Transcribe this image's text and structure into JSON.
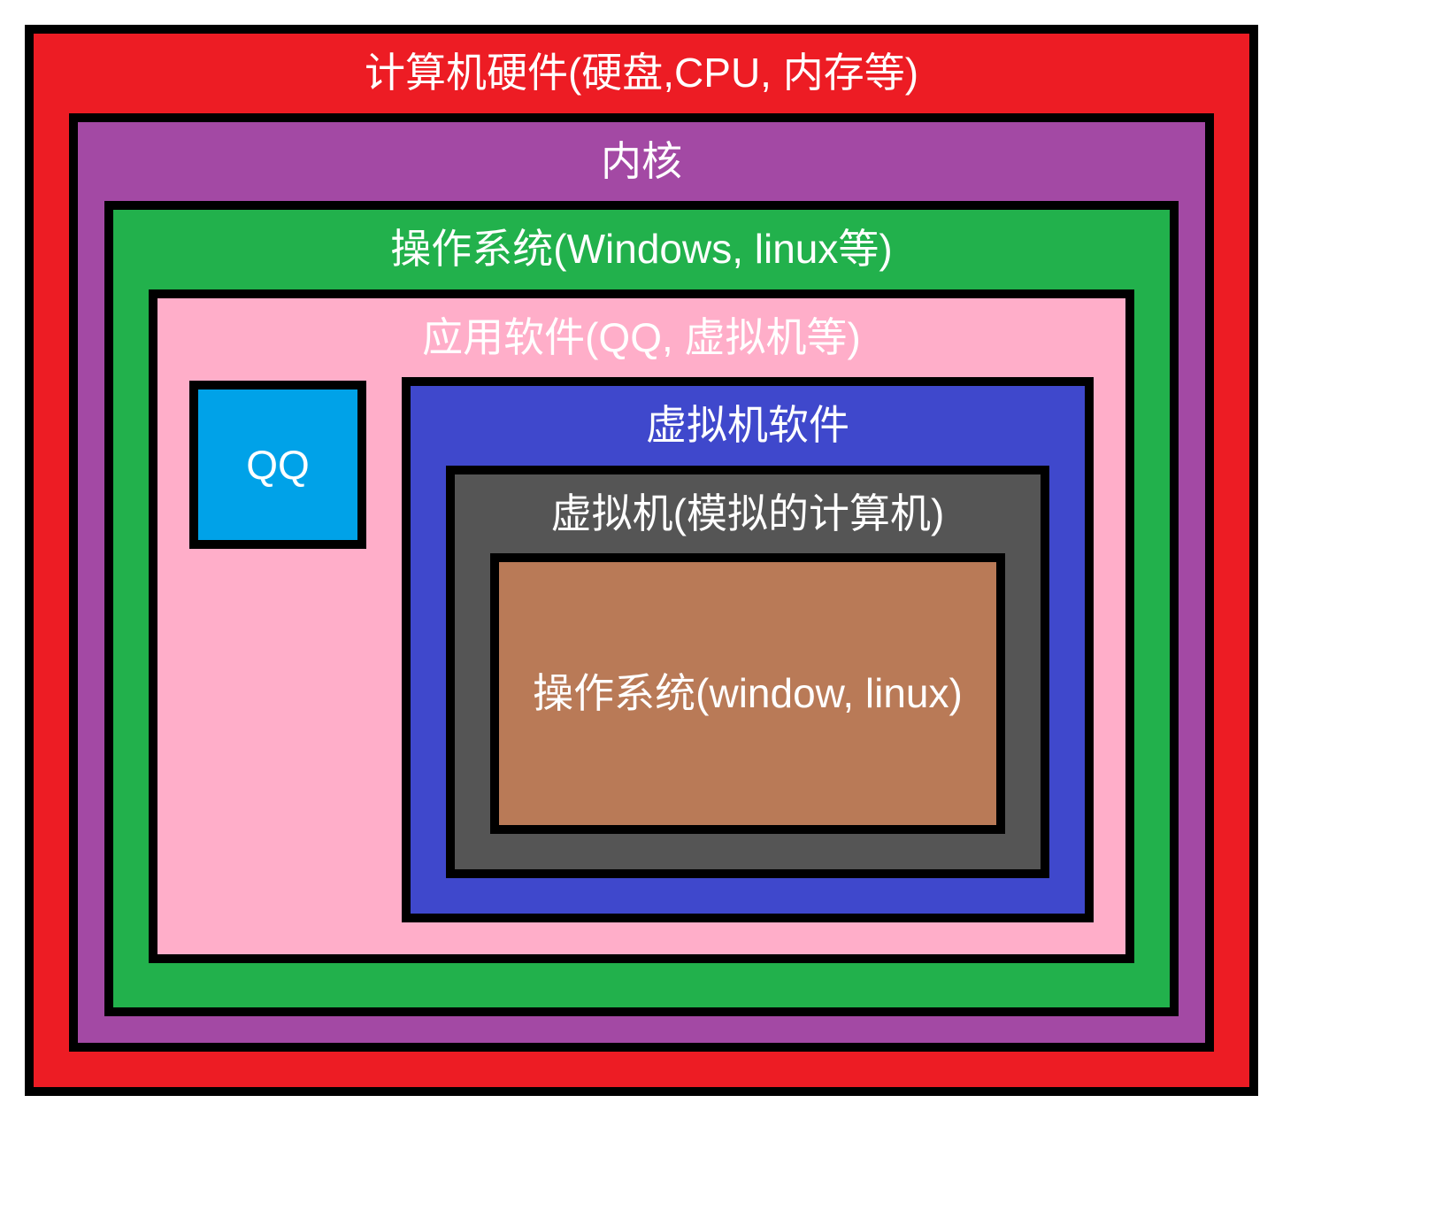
{
  "layers": {
    "hardware": "计算机硬件(硬盘,CPU, 内存等)",
    "kernel": "内核",
    "os": "操作系统(Windows, linux等)",
    "apps": "应用软件(QQ, 虚拟机等)",
    "qq": "QQ",
    "vm_software": "虚拟机软件",
    "vm_machine": "虚拟机(模拟的计算机)",
    "vm_os": "操作系统(window, linux)"
  },
  "colors": {
    "hardware": "#ed1c24",
    "kernel": "#a349a4",
    "os": "#22b14c",
    "apps": "#ffaec9",
    "qq": "#00a2e8",
    "vm_software": "#3f48cc",
    "vm_machine": "#555555",
    "vm_os": "#b97a57",
    "border": "#000000",
    "text": "#ffffff"
  }
}
